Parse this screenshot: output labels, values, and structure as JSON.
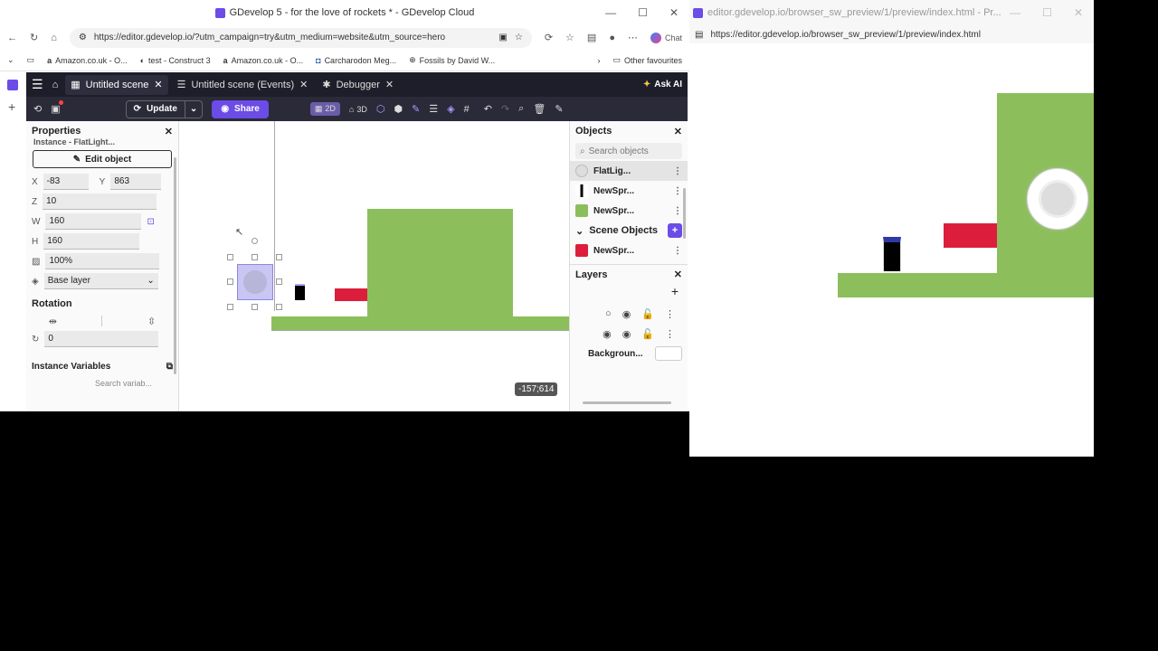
{
  "browser1": {
    "title": "GDevelop 5 - for the love of rockets * - GDevelop Cloud",
    "url": "https://editor.gdevelop.io/?utm_campaign=try&utm_medium=website&utm_source=hero",
    "chat": "Chat",
    "favourites": [
      "Amazon.co.uk - O...",
      "test - Construct 3",
      "Amazon.co.uk - O...",
      "Carcharodon Meg...",
      "Fossils by David W..."
    ],
    "other_favs": "Other favourites"
  },
  "browser2": {
    "title": "editor.gdevelop.io/browser_sw_preview/1/preview/index.html - Pr...",
    "url": "https://editor.gdevelop.io/browser_sw_preview/1/preview/index.html"
  },
  "editor": {
    "tabs": [
      "Untitled scene",
      "Untitled scene (Events)",
      "Debugger"
    ],
    "ask_ai": "Ask AI",
    "update": "Update",
    "share": "Share",
    "mode2d": "2D",
    "mode3d": "3D",
    "properties": {
      "title": "Properties",
      "instance_label": "Instance - FlatLight...",
      "edit": "Edit object",
      "x_label": "X",
      "x": "-83",
      "y_label": "Y",
      "y": "863",
      "z_label": "Z",
      "z": "10",
      "w_label": "W",
      "w": "160",
      "h_label": "H",
      "h": "160",
      "opacity": "100%",
      "layer": "Base layer",
      "rotation_title": "Rotation",
      "angle": "0",
      "inst_vars": "Instance Variables",
      "search_vars": "Search variab..."
    },
    "coords": "-157;614",
    "objects": {
      "title": "Objects",
      "search": "Search objects",
      "items": [
        "FlatLig...",
        "NewSpr...",
        "NewSpr..."
      ],
      "scene_objects": "Scene Objects",
      "scene_items": [
        "NewSpr..."
      ]
    },
    "layers": {
      "title": "Layers",
      "background": "Backgroun..."
    }
  },
  "colors": {
    "green": "#8cbf5c",
    "red": "#dc1e3c",
    "accent": "#6b4ce6"
  }
}
